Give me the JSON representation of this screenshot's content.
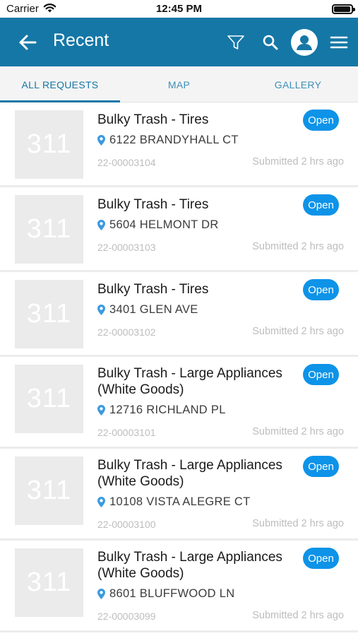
{
  "status_bar": {
    "carrier": "Carrier",
    "time": "12:45 PM"
  },
  "app_bar": {
    "title": "Recent",
    "color": "#1577a6",
    "icons": [
      "back-arrow-icon",
      "filter-icon",
      "search-icon",
      "avatar",
      "hamburger-menu-icon"
    ]
  },
  "tabs": [
    {
      "label": "ALL REQUESTS",
      "active": true
    },
    {
      "label": "MAP",
      "active": false
    },
    {
      "label": "GALLERY",
      "active": false
    }
  ],
  "requests": [
    {
      "thumb": "311",
      "title": "Bulky Trash - Tires",
      "status": "Open",
      "address": "6122 BRANDYHALL CT",
      "id": "22-00003104",
      "submitted": "Submitted 2 hrs ago"
    },
    {
      "thumb": "311",
      "title": "Bulky Trash - Tires",
      "status": "Open",
      "address": "5604 HELMONT DR",
      "id": "22-00003103",
      "submitted": "Submitted 2 hrs ago"
    },
    {
      "thumb": "311",
      "title": "Bulky Trash - Tires",
      "status": "Open",
      "address": "3401 GLEN AVE",
      "id": "22-00003102",
      "submitted": "Submitted 2 hrs ago"
    },
    {
      "thumb": "311",
      "title": "Bulky Trash - Large Appliances (White Goods)",
      "status": "Open",
      "address": "12716 RICHLAND PL",
      "id": "22-00003101",
      "submitted": "Submitted 2 hrs ago"
    },
    {
      "thumb": "311",
      "title": "Bulky Trash - Large Appliances (White Goods)",
      "status": "Open",
      "address": "10108 VISTA ALEGRE CT",
      "id": "22-00003100",
      "submitted": "Submitted 2 hrs ago"
    },
    {
      "thumb": "311",
      "title": "Bulky Trash - Large Appliances (White Goods)",
      "status": "Open",
      "address": "8601 BLUFFWOOD LN",
      "id": "22-00003099",
      "submitted": "Submitted 2 hrs ago"
    }
  ],
  "colors": {
    "badge": "#0d93e8",
    "pin": "#3b9ae0",
    "thumb_bg": "#ebebeb"
  }
}
